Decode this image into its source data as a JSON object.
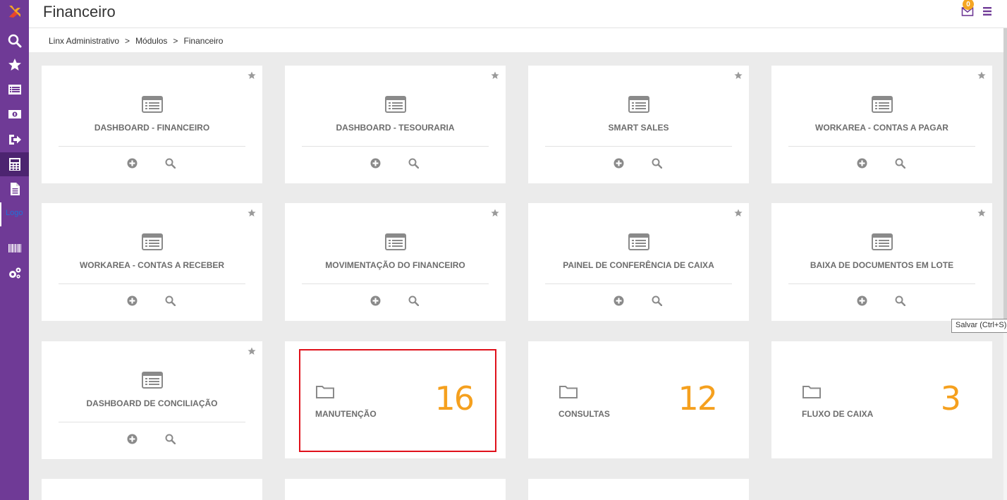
{
  "header": {
    "title": "Financeiro",
    "mail_badge": "0"
  },
  "breadcrumb": [
    "Linx Administrativo",
    "Módulos",
    "Financeiro"
  ],
  "breadcrumb_sep": ">",
  "sidebar": {
    "hover_tooltip": "Logo",
    "items": [
      "search-icon",
      "star-icon",
      "list-icon",
      "money-icon",
      "sign-out-icon",
      "calculator-icon",
      "document-icon",
      "barcode-icon",
      "gears-icon"
    ]
  },
  "cards": [
    {
      "label": "DASHBOARD - FINANCEIRO"
    },
    {
      "label": "DASHBOARD - TESOURARIA"
    },
    {
      "label": "SMART SALES"
    },
    {
      "label": "WORKAREA - CONTAS A PAGAR"
    },
    {
      "label": "WORKAREA - CONTAS A RECEBER"
    },
    {
      "label": "MOVIMENTAÇÃO DO FINANCEIRO"
    },
    {
      "label": "PAINEL DE CONFERÊNCIA DE CAIXA"
    },
    {
      "label": "BAIXA DE DOCUMENTOS EM LOTE"
    },
    {
      "label": "DASHBOARD DE CONCILIAÇÃO"
    }
  ],
  "folders": [
    {
      "label": "MANUTENÇÃO",
      "count": "16"
    },
    {
      "label": "CONSULTAS",
      "count": "12"
    },
    {
      "label": "FLUXO DE CAIXA",
      "count": "3"
    }
  ],
  "tooltip": "Salvar (Ctrl+S)",
  "colors": {
    "sidebar": "#6f3a96",
    "accent": "#f5a01e",
    "highlight": "#e0111b"
  }
}
